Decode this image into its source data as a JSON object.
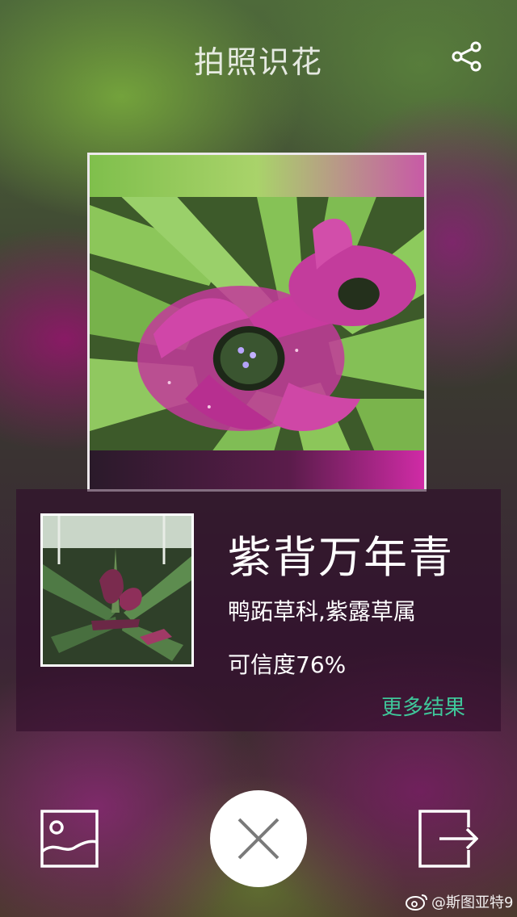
{
  "header": {
    "title": "拍照识花",
    "share_icon": "share-icon"
  },
  "result": {
    "name": "紫背万年青",
    "family": "鸭跖草科,紫露草属",
    "confidence": "可信度76%",
    "more_label": "更多结果"
  },
  "controls": {
    "gallery_icon": "gallery-icon",
    "close_icon": "close-icon",
    "exit_icon": "exit-icon"
  },
  "watermark": {
    "text": "@斯图亚特9",
    "icon": "weibo-logo"
  },
  "colors": {
    "accent_green": "#3fc79a",
    "white": "#ffffff"
  }
}
